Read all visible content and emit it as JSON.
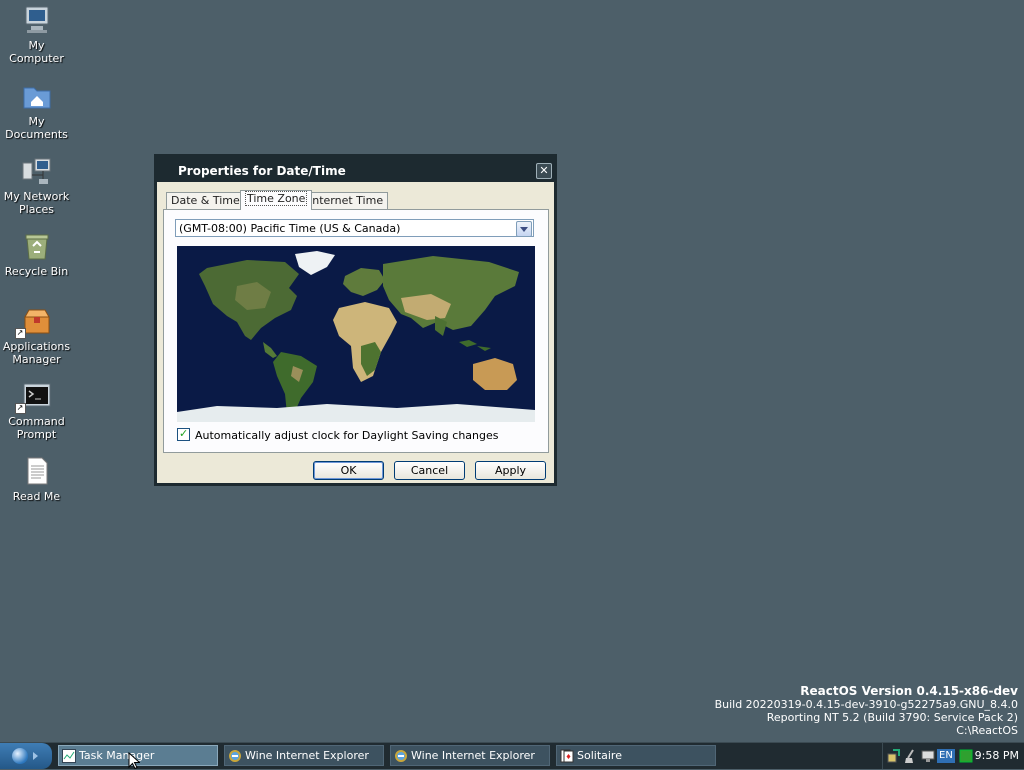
{
  "desktop": {
    "icons": [
      {
        "label": "My\nComputer",
        "icon": "computer-icon"
      },
      {
        "label": "My\nDocuments",
        "icon": "documents-folder-icon"
      },
      {
        "label": "My Network\nPlaces",
        "icon": "network-places-icon"
      },
      {
        "label": "Recycle Bin",
        "icon": "recycle-bin-icon"
      },
      {
        "label": "Applications\nManager",
        "icon": "applications-manager-icon"
      },
      {
        "label": "Command\nPrompt",
        "icon": "command-prompt-icon"
      },
      {
        "label": "Read Me",
        "icon": "text-document-icon"
      }
    ]
  },
  "dialog": {
    "title": "Properties for Date/Time",
    "tabs": [
      {
        "label": "Date & Time",
        "active": false
      },
      {
        "label": "Time Zone",
        "active": true
      },
      {
        "label": "Internet Time",
        "active": false
      }
    ],
    "timezone_selected": "(GMT-08:00) Pacific Time (US & Canada)",
    "dst_checkbox": {
      "label": "Automatically adjust clock for Daylight Saving changes",
      "checked": true
    },
    "buttons": {
      "ok": "OK",
      "cancel": "Cancel",
      "apply": "Apply"
    }
  },
  "version_info": {
    "line1": "ReactOS Version 0.4.15-x86-dev",
    "line2": "Build 20220319-0.4.15-dev-3910-g52275a9.GNU_8.4.0",
    "line3": "Reporting NT 5.2 (Build 3790: Service Pack 2)",
    "line4": "C:\\ReactOS"
  },
  "taskbar": {
    "tasks": [
      {
        "label": "Task Manager",
        "active": true,
        "icon": "task-manager-icon"
      },
      {
        "label": "Wine Internet Explorer",
        "active": false,
        "icon": "internet-explorer-icon"
      },
      {
        "label": "Wine Internet Explorer",
        "active": false,
        "icon": "internet-explorer-icon"
      },
      {
        "label": "Solitaire",
        "active": false,
        "icon": "solitaire-icon"
      }
    ],
    "language": "EN",
    "clock": "9:58 PM"
  }
}
